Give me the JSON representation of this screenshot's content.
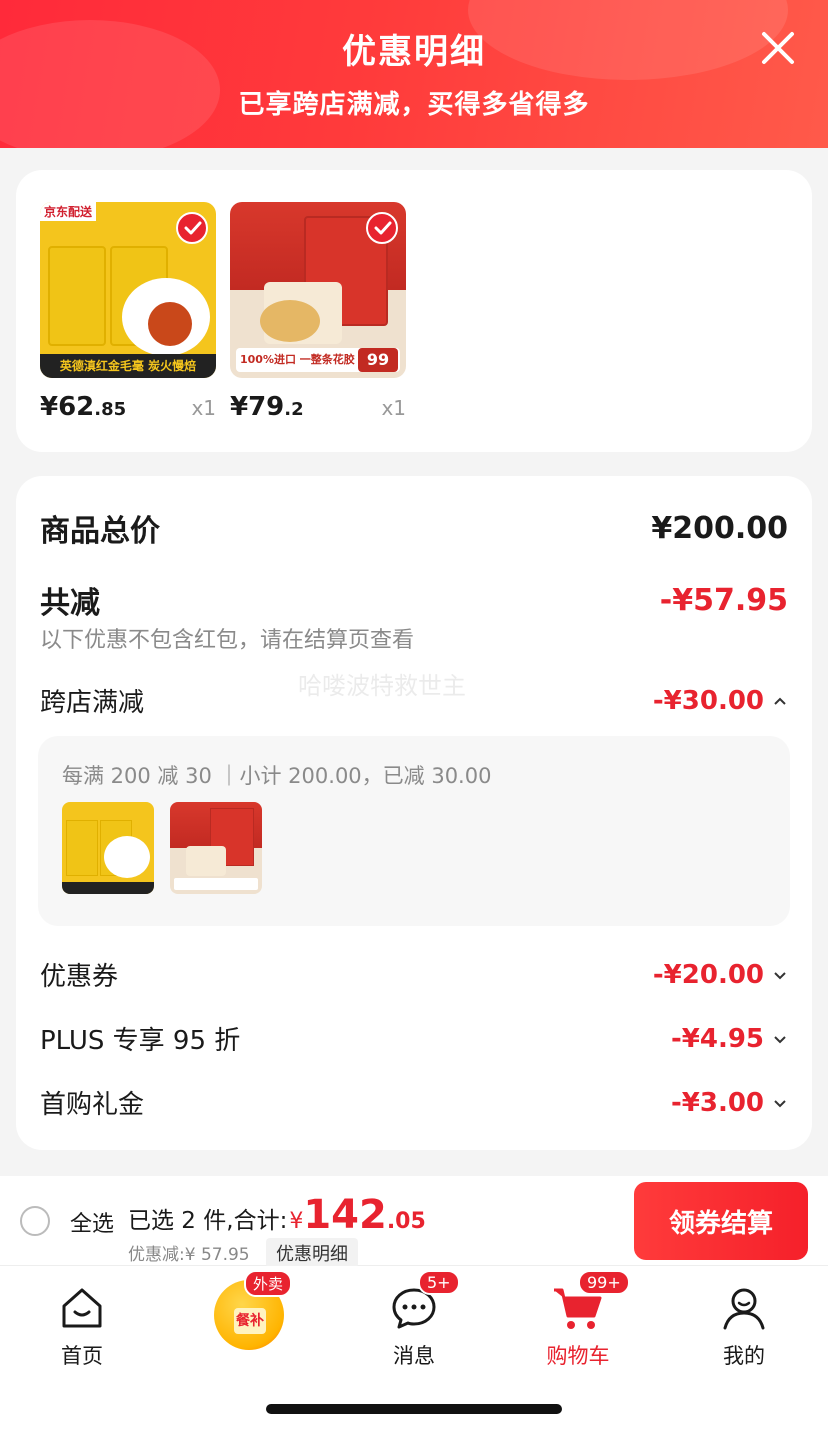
{
  "header": {
    "title": "优惠明细",
    "subtitle": "已享跨店满减，买得多省得多",
    "close_icon": "close-icon"
  },
  "products": [
    {
      "price_int": "¥62",
      "price_dec": ".85",
      "qty": "x1",
      "image_text": "英德滇红金毛毫 炭火慢焙",
      "tag": "京东配送"
    },
    {
      "price_int": "¥79",
      "price_dec": ".2",
      "qty": "x1",
      "image_text": "100%进口 一整条花胶",
      "tag": "99"
    }
  ],
  "summary": {
    "total_label": "商品总价",
    "total_value": "¥200.00",
    "reduce_label": "共减",
    "reduce_value": "-¥57.95",
    "note": "以下优惠不包含红包，请在结算页查看",
    "watermark": "哈喽波特救世主",
    "cross_store_label": "跨店满减",
    "cross_store_value": "-¥30.00",
    "cross_store_desc": "每满 200 减 30 ｜小计 200.00，已减 30.00",
    "coupon_label": "优惠券",
    "coupon_value": "-¥20.00",
    "plus_label": "PLUS 专享 95 折",
    "plus_value": "-¥4.95",
    "first_label": "首购礼金",
    "first_value": "-¥3.00"
  },
  "bottom_bar": {
    "select_all": "全选",
    "selected_text": "已选 2 件,合计:",
    "yen": "¥",
    "amount_int": "142",
    "amount_dec": ".05",
    "discount_text": "优惠减:¥ 57.95",
    "detail_link": "优惠明细",
    "checkout_label": "领券结算"
  },
  "tabbar": {
    "tabs": [
      {
        "label": "首页",
        "icon": "home-icon"
      },
      {
        "label": "",
        "icon": "meal-subsidy-icon",
        "badge": "外卖",
        "inner": "餐补"
      },
      {
        "label": "消息",
        "icon": "message-icon",
        "badge": "5+"
      },
      {
        "label": "购物车",
        "icon": "cart-icon",
        "badge": "99+"
      },
      {
        "label": "我的",
        "icon": "profile-icon"
      }
    ]
  },
  "colors": {
    "accent": "#e8232f",
    "header": "#ff3b3b"
  }
}
